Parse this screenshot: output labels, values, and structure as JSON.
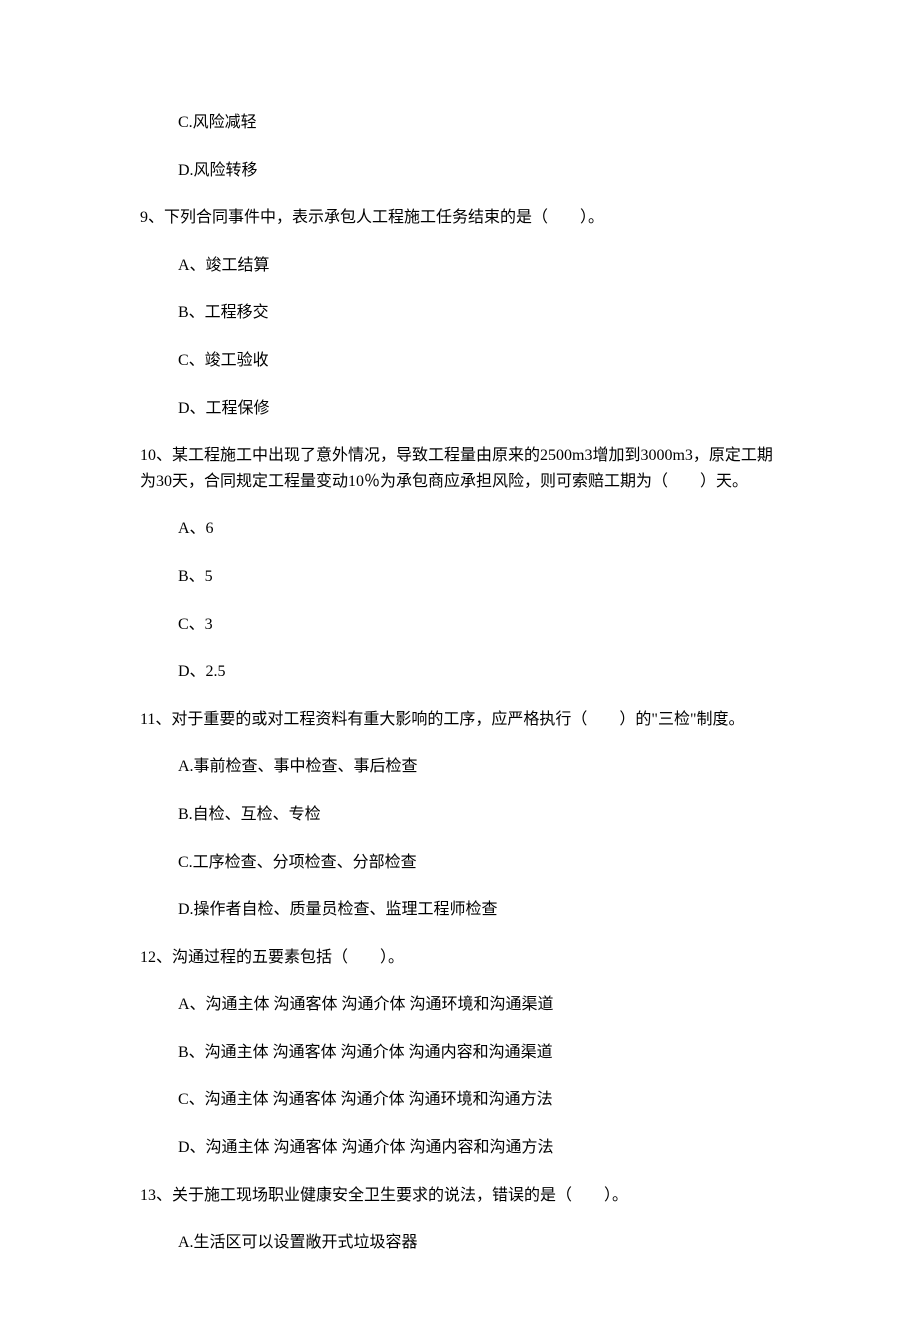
{
  "prior_options": {
    "c": "C.风险减轻",
    "d": "D.风险转移"
  },
  "q9": {
    "text": "9、下列合同事件中，表示承包人工程施工任务结束的是（　　）。",
    "options": {
      "a": "A、竣工结算",
      "b": "B、工程移交",
      "c": "C、竣工验收",
      "d": "D、工程保修"
    }
  },
  "q10": {
    "text": "10、某工程施工中出现了意外情况，导致工程量由原来的2500m3增加到3000m3，原定工期为30天，合同规定工程量变动10％为承包商应承担风险，则可索赔工期为（　　）天。",
    "options": {
      "a": "A、6",
      "b": "B、5",
      "c": "C、3",
      "d": "D、2.5"
    }
  },
  "q11": {
    "text": "11、对于重要的或对工程资料有重大影响的工序，应严格执行（　　）的\"三检\"制度。",
    "options": {
      "a": "A.事前检查、事中检查、事后检查",
      "b": "B.自检、互检、专检",
      "c": "C.工序检查、分项检查、分部检查",
      "d": "D.操作者自检、质量员检查、监理工程师检查"
    }
  },
  "q12": {
    "text": "12、沟通过程的五要素包括（　　）。",
    "options": {
      "a": "A、沟通主体 沟通客体 沟通介体 沟通环境和沟通渠道",
      "b": "B、沟通主体 沟通客体 沟通介体 沟通内容和沟通渠道",
      "c": "C、沟通主体 沟通客体 沟通介体 沟通环境和沟通方法",
      "d": "D、沟通主体 沟通客体 沟通介体 沟通内容和沟通方法"
    }
  },
  "q13": {
    "text": "13、关于施工现场职业健康安全卫生要求的说法，错误的是（　　）。",
    "options": {
      "a": "A.生活区可以设置敞开式垃圾容器"
    }
  }
}
